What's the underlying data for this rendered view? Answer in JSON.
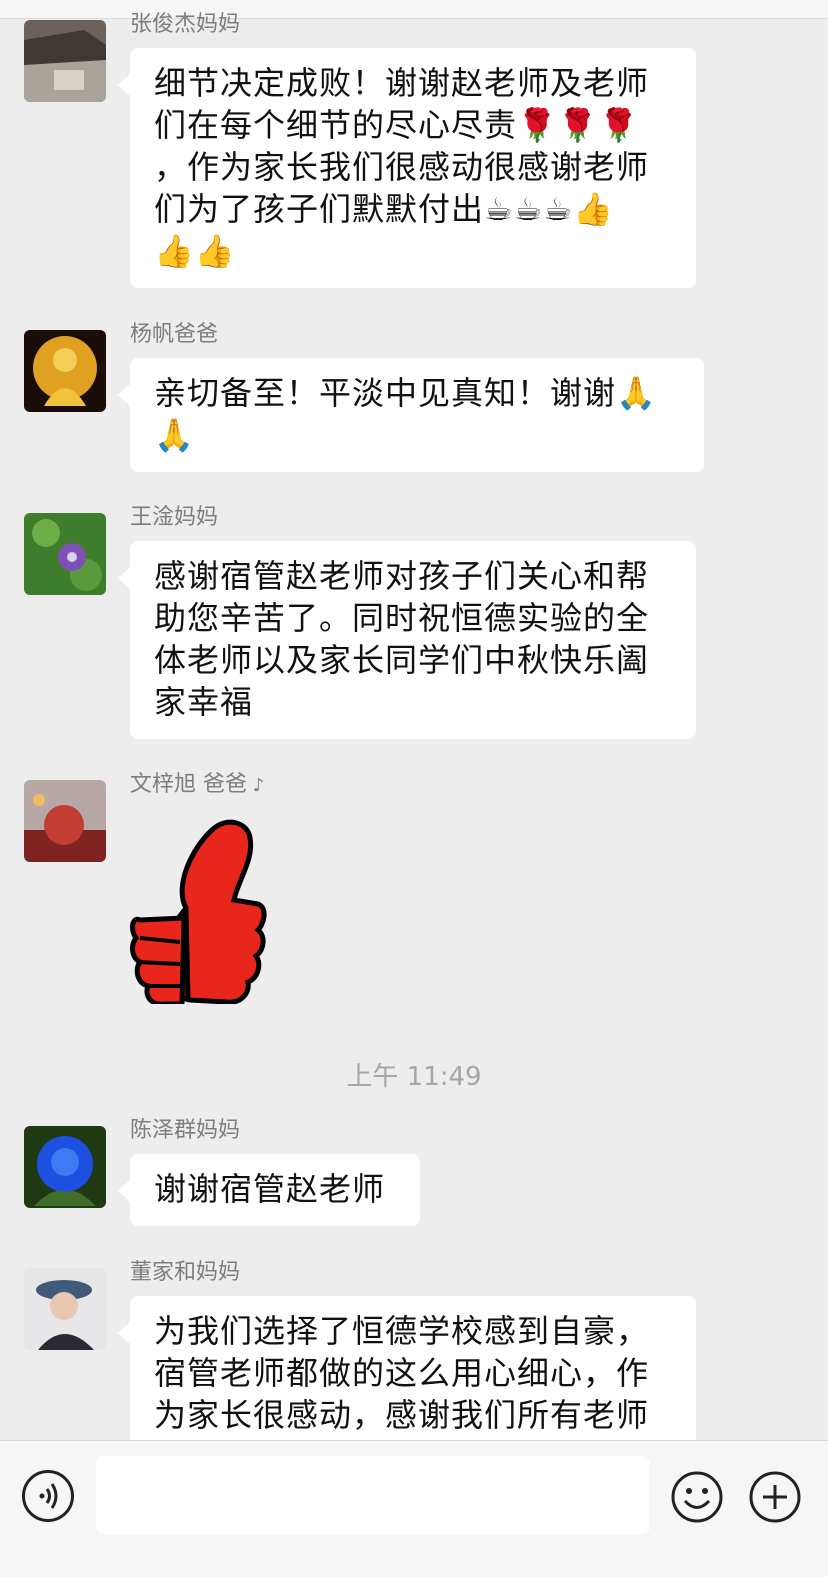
{
  "messages": [
    {
      "sender": "张俊杰妈妈",
      "lines": [
        "细节决定成败！谢谢赵老师及老师",
        "们在每个细节的尽心尽责🌹🌹🌹",
        "，作为家长我们很感动很感谢老师",
        "们为了孩子们默默付出☕☕☕👍",
        "👍👍"
      ]
    },
    {
      "sender": "杨帆爸爸",
      "lines": [
        "亲切备至！平淡中见真知！谢谢🙏",
        "🙏"
      ]
    },
    {
      "sender": "王淦妈妈",
      "lines": [
        "感谢宿管赵老师对孩子们关心和帮",
        "助您辛苦了。同时祝恒德实验的全",
        "体老师以及家长同学们中秋快乐阖",
        "家幸福"
      ]
    },
    {
      "sender": "文梓旭 爸爸",
      "sticker": "thumbs-up-sticker"
    },
    {
      "sender": "陈泽群妈妈",
      "lines": [
        "谢谢宿管赵老师"
      ]
    },
    {
      "sender": "董家和妈妈",
      "lines": [
        "为我们选择了恒德学校感到自豪，",
        "宿管老师都做的这么用心细心，作",
        "为家长很感动，感谢我们所有老师"
      ]
    }
  ],
  "timestamp": "上午 11:49",
  "colors": {
    "background": "#ededed",
    "bubble": "#ffffff",
    "sender": "#7d7d7d",
    "sticker_red": "#e8261c"
  },
  "icons": [
    "voice-icon",
    "emoji-icon",
    "plus-icon"
  ]
}
